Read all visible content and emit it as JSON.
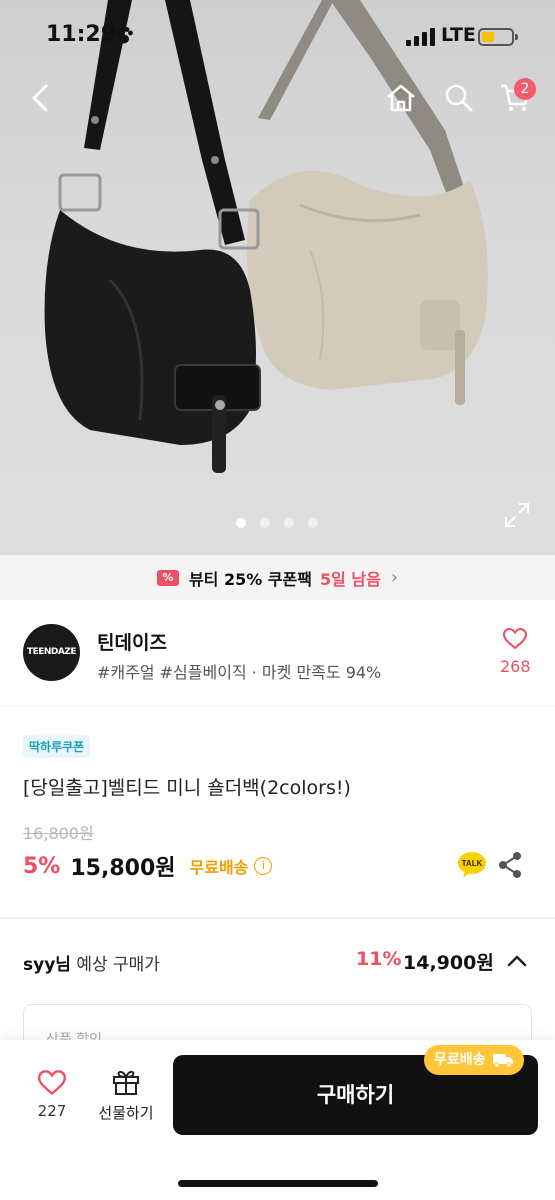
{
  "status_bar": {
    "time": "11:29",
    "carrier": "LTE"
  },
  "header": {
    "cart_count": "2"
  },
  "hero": {
    "slide_count": 4,
    "active_slide": 1
  },
  "promo_banner": {
    "text": "뷰티 25% 쿠폰팩",
    "highlight": "5일 남음",
    "icon_text": "%"
  },
  "shop": {
    "logo_text": "TEENDAZE",
    "name": "틴데이즈",
    "tags": "#캐주얼 #심플베이직 · 마켓 만족도 94%",
    "likes": "268"
  },
  "product": {
    "coupon_tag": "딱하루쿠폰",
    "title": "[당일출고]벨티드 미니 숄더백(2colors!)",
    "original_price": "16,800원",
    "discount": "5%",
    "price": "15,800원",
    "shipping": "무료배송",
    "info_icon": "i",
    "talk_label": "TALK"
  },
  "expected_price": {
    "user": "syy님",
    "label": "예상 구매가",
    "discount": "11%",
    "price": "14,900원"
  },
  "detail_box": {
    "partial_text": "상품 할인"
  },
  "bottom_bar": {
    "like_count": "227",
    "gift_label": "선물하기",
    "buy_label": "구매하기",
    "free_ship_badge": "무료배송"
  },
  "colors": {
    "accent_red": "#ee4f63",
    "shipping_orange": "#f0a000",
    "badge_yellow": "#ffc63a"
  }
}
